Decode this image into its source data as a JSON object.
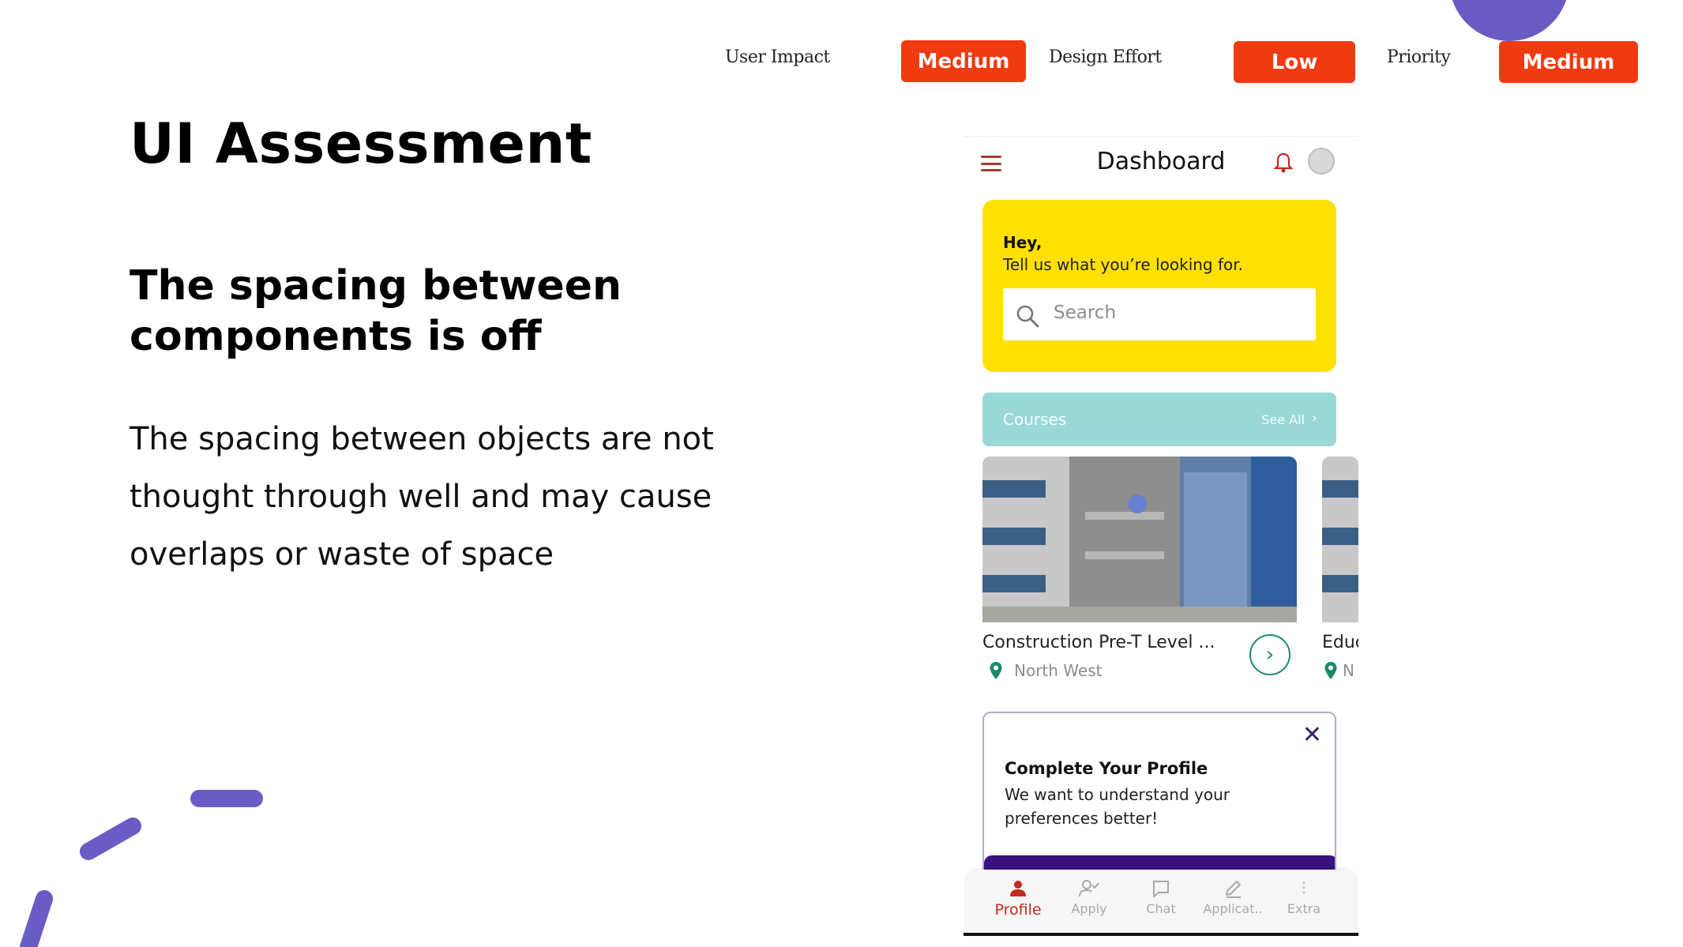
{
  "rating": {
    "user_impact_label": "User Impact",
    "user_impact_value": "Medium",
    "design_effort_label": "Design Effort",
    "design_effort_value": "Low",
    "priority_label": "Priority",
    "priority_value": "Medium"
  },
  "slide": {
    "title": "UI Assessment",
    "heading": "The spacing between components is off",
    "body": "The spacing between objects are not thought through well and may cause overlaps or waste of space"
  },
  "app": {
    "header_title": "Dashboard",
    "hero": {
      "greeting": "Hey,",
      "prompt": "Tell us what you’re looking for.",
      "search_placeholder": "Search"
    },
    "courses": {
      "label": "Courses",
      "see_all": "See All",
      "items": [
        {
          "title": "Construction Pre-T Level ...",
          "location": "North West"
        },
        {
          "title": "Educ",
          "location": "N"
        }
      ]
    },
    "profile_prompt": {
      "title": "Complete Your Profile",
      "text": "We want to understand your preferences better!"
    },
    "nav": [
      {
        "label": "Profile",
        "icon": "person-icon",
        "active": true
      },
      {
        "label": "Apply",
        "icon": "user-check-icon"
      },
      {
        "label": "Chat",
        "icon": "chat-icon"
      },
      {
        "label": "Applicat..",
        "icon": "pencil-icon"
      },
      {
        "label": "Extra",
        "icon": "more-icon"
      }
    ]
  },
  "colors": {
    "badge": "#f03a10",
    "accent_purple": "#6a5cc4",
    "hero_yellow": "#ffe000",
    "courses_teal": "#9ad8d8",
    "nav_active": "#c22a1e"
  }
}
